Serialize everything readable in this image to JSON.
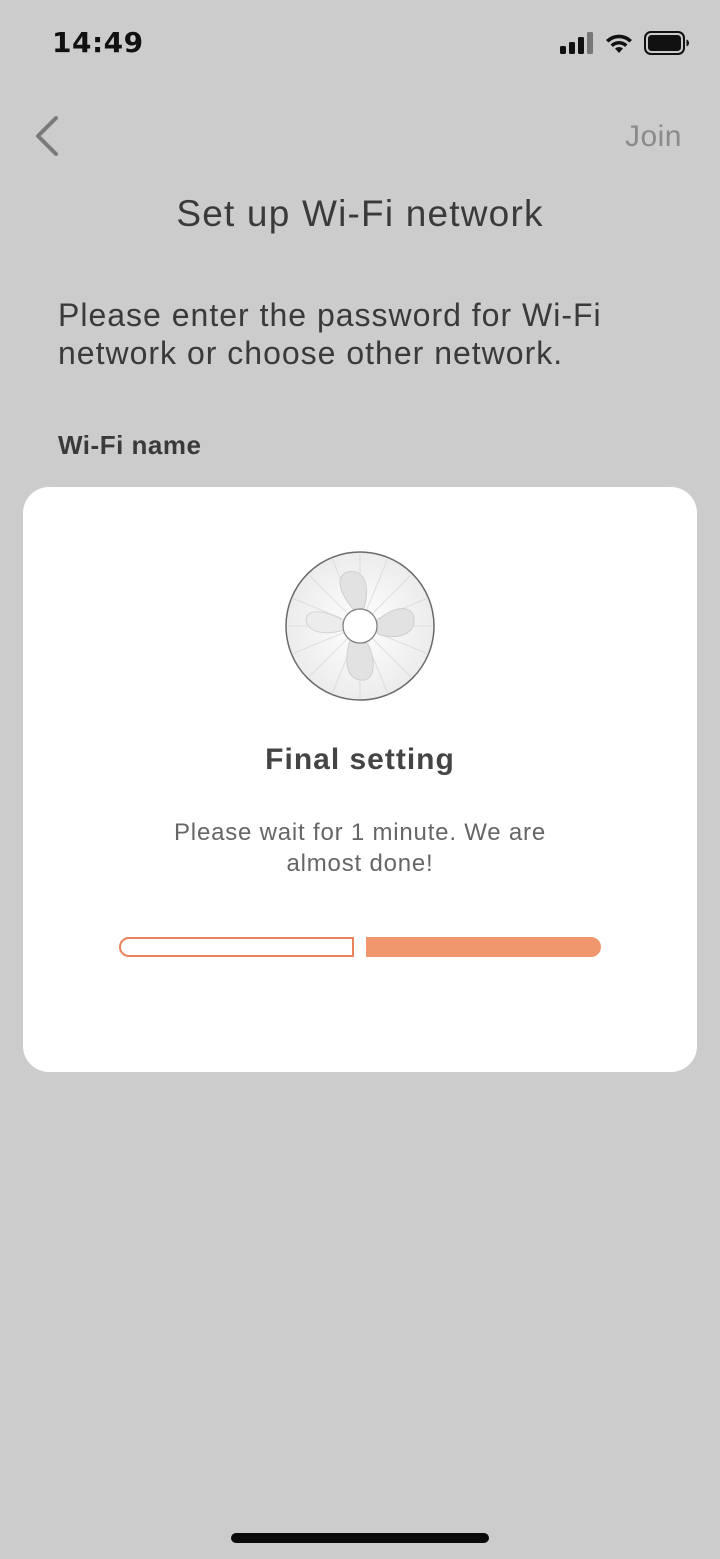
{
  "status_bar": {
    "time": "14:49",
    "icons": [
      "cellular-signal-icon",
      "wifi-icon",
      "battery-icon"
    ]
  },
  "nav": {
    "back_icon": "chevron-left-icon",
    "join_label": "Join"
  },
  "page": {
    "title": "Set up Wi-Fi network",
    "instruction": "Please enter the password for Wi-Fi network or choose other network.",
    "wifi_name_label": "Wi-Fi name"
  },
  "modal": {
    "image": "fan-icon",
    "title": "Final setting",
    "message": "Please wait for 1 minute. We are almost done!",
    "progress": {
      "total_steps": 2,
      "completed_steps": [
        false,
        true
      ]
    }
  },
  "colors": {
    "background_overlay": "#cccccc",
    "modal_background": "#ffffff",
    "accent": "#f0976d",
    "accent_border": "#e8835a",
    "muted_text": "#8a8a8a"
  }
}
